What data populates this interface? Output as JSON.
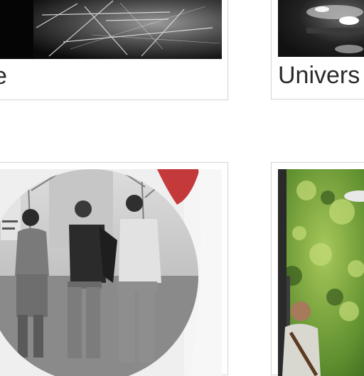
{
  "gallery": {
    "cards": [
      {
        "caption": "e",
        "image": "black-and-white-abstract-light-streaks"
      },
      {
        "caption": "Univers",
        "image": "night-scene-bright-lights"
      },
      {
        "caption": "",
        "image": "vintage-photo-three-people-in-circle-frame"
      },
      {
        "caption": "",
        "image": "outdoor-performer-with-guitar-under-trees"
      }
    ]
  }
}
